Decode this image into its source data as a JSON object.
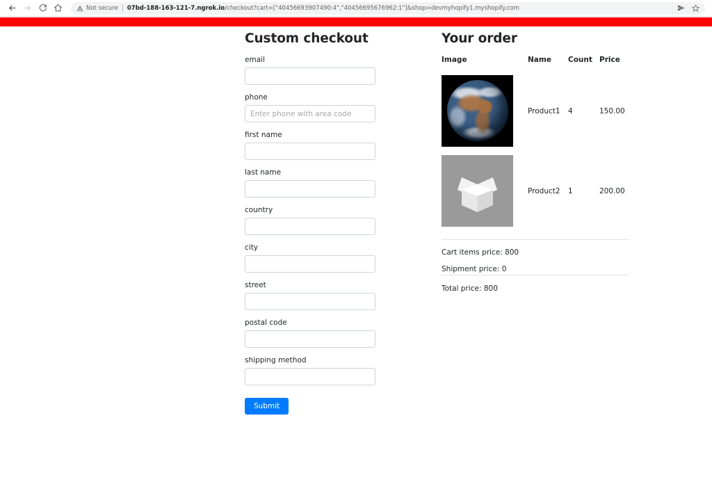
{
  "browser": {
    "back_label": "Back",
    "forward_label": "Forward",
    "reload_label": "Reload",
    "home_label": "Home",
    "security_text": "Not secure",
    "url_host": "07bd-188-163-121-7.ngrok.io",
    "url_path": "/checkout?cart=[\"40456693907490:4\",\"40456695676962:1\"]&shop=devmyhopify1.myshopify.com",
    "share_label": "Share",
    "bookmark_label": "Bookmark this tab"
  },
  "banner": {
    "color": "#fb0505"
  },
  "checkout": {
    "title": "Custom checkout",
    "fields": [
      {
        "label": "email",
        "value": "",
        "placeholder": ""
      },
      {
        "label": "phone",
        "value": "",
        "placeholder": "Enter phone with area code"
      },
      {
        "label": "first name",
        "value": "",
        "placeholder": ""
      },
      {
        "label": "last name",
        "value": "",
        "placeholder": ""
      },
      {
        "label": "country",
        "value": "",
        "placeholder": ""
      },
      {
        "label": "city",
        "value": "",
        "placeholder": ""
      },
      {
        "label": "street",
        "value": "",
        "placeholder": ""
      },
      {
        "label": "postal code",
        "value": "",
        "placeholder": ""
      },
      {
        "label": "shipping method",
        "value": "",
        "placeholder": ""
      }
    ],
    "submit_label": "Submit",
    "submit_color": "#007bff"
  },
  "order": {
    "title": "Your order",
    "columns": [
      "Image",
      "Name",
      "Count",
      "Price"
    ],
    "items": [
      {
        "image": "earth-photo",
        "name": "Product1",
        "count": "4",
        "price": "150.00"
      },
      {
        "image": "box-placeholder",
        "name": "Product2",
        "count": "1",
        "price": "200.00"
      }
    ],
    "cart_items_price": "Cart items price: 800",
    "shipment_price": "Shipment price: 0",
    "total_price": "Total price: 800"
  }
}
